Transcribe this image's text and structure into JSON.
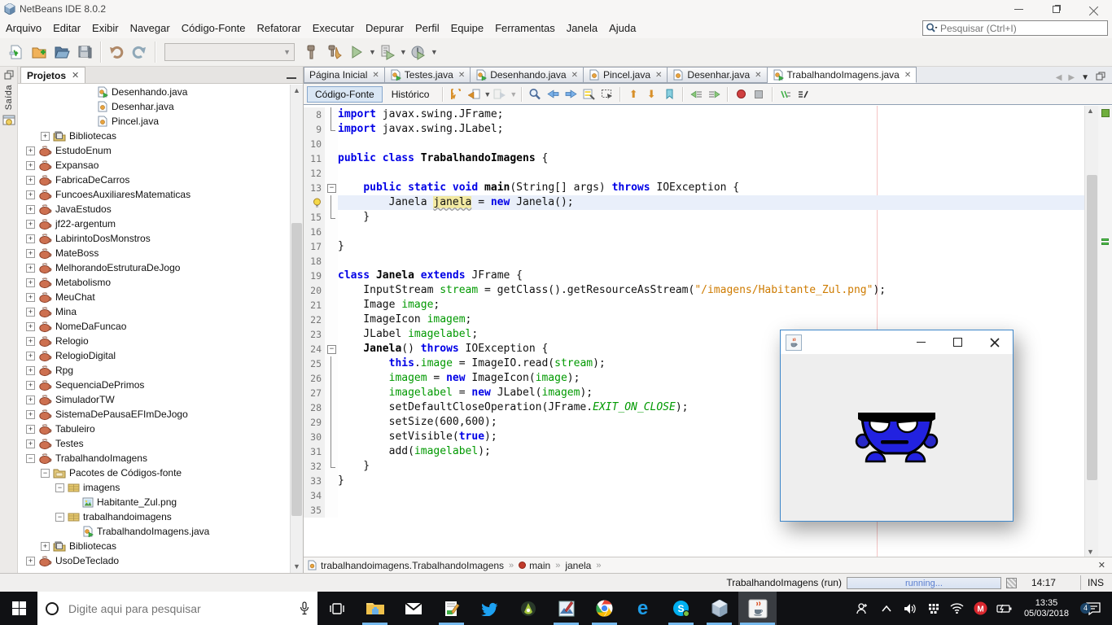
{
  "titlebar": {
    "title": "NetBeans IDE 8.0.2"
  },
  "menubar": {
    "items": [
      "Arquivo",
      "Editar",
      "Exibir",
      "Navegar",
      "Código-Fonte",
      "Refatorar",
      "Executar",
      "Depurar",
      "Perfil",
      "Equipe",
      "Ferramentas",
      "Janela",
      "Ajuda"
    ]
  },
  "quick_search": {
    "placeholder": "Pesquisar (Ctrl+I)"
  },
  "left_dock": {
    "output_label": "Saída"
  },
  "projects_panel": {
    "title": "Projetos",
    "tree": [
      {
        "lvl": 4,
        "box": "",
        "icon": "java-main",
        "label": "Desenhando.java"
      },
      {
        "lvl": 4,
        "box": "",
        "icon": "java",
        "label": "Desenhar.java"
      },
      {
        "lvl": 4,
        "box": "",
        "icon": "java",
        "label": "Pincel.java"
      },
      {
        "lvl": 1,
        "box": "+",
        "icon": "lib",
        "label": "Bibliotecas"
      },
      {
        "lvl": 0,
        "box": "+",
        "icon": "prj",
        "label": "EstudoEnum"
      },
      {
        "lvl": 0,
        "box": "+",
        "icon": "prj",
        "label": "Expansao"
      },
      {
        "lvl": 0,
        "box": "+",
        "icon": "prj",
        "label": "FabricaDeCarros"
      },
      {
        "lvl": 0,
        "box": "+",
        "icon": "prj",
        "label": "FuncoesAuxiliaresMatematicas"
      },
      {
        "lvl": 0,
        "box": "+",
        "icon": "prj",
        "label": "JavaEstudos"
      },
      {
        "lvl": 0,
        "box": "+",
        "icon": "prj",
        "label": "jf22-argentum"
      },
      {
        "lvl": 0,
        "box": "+",
        "icon": "prj",
        "label": "LabirintoDosMonstros"
      },
      {
        "lvl": 0,
        "box": "+",
        "icon": "prj",
        "label": "MateBoss"
      },
      {
        "lvl": 0,
        "box": "+",
        "icon": "prj",
        "label": "MelhorandoEstruturaDeJogo"
      },
      {
        "lvl": 0,
        "box": "+",
        "icon": "prj",
        "label": "Metabolismo"
      },
      {
        "lvl": 0,
        "box": "+",
        "icon": "prj",
        "label": "MeuChat"
      },
      {
        "lvl": 0,
        "box": "+",
        "icon": "prj",
        "label": "Mina"
      },
      {
        "lvl": 0,
        "box": "+",
        "icon": "prj",
        "label": "NomeDaFuncao"
      },
      {
        "lvl": 0,
        "box": "+",
        "icon": "prj",
        "label": "Relogio"
      },
      {
        "lvl": 0,
        "box": "+",
        "icon": "prj",
        "label": "RelogioDigital"
      },
      {
        "lvl": 0,
        "box": "+",
        "icon": "prj",
        "label": "Rpg"
      },
      {
        "lvl": 0,
        "box": "+",
        "icon": "prj",
        "label": "SequenciaDePrimos"
      },
      {
        "lvl": 0,
        "box": "+",
        "icon": "prj",
        "label": "SimuladorTW"
      },
      {
        "lvl": 0,
        "box": "+",
        "icon": "prj",
        "label": "SistemaDePausaEFImDeJogo"
      },
      {
        "lvl": 0,
        "box": "+",
        "icon": "prj",
        "label": "Tabuleiro"
      },
      {
        "lvl": 0,
        "box": "+",
        "icon": "prj",
        "label": "Testes"
      },
      {
        "lvl": 0,
        "box": "-",
        "icon": "prj",
        "label": "TrabalhandoImagens"
      },
      {
        "lvl": 1,
        "box": "-",
        "icon": "srcroot",
        "label": "Pacotes de Códigos-fonte"
      },
      {
        "lvl": 2,
        "box": "-",
        "icon": "pkg",
        "label": "imagens"
      },
      {
        "lvl": 3,
        "box": "",
        "icon": "img",
        "label": "Habitante_Zul.png"
      },
      {
        "lvl": 2,
        "box": "-",
        "icon": "pkg",
        "label": "trabalhandoimagens"
      },
      {
        "lvl": 3,
        "box": "",
        "icon": "java-main",
        "label": "TrabalhandoImagens.java"
      },
      {
        "lvl": 1,
        "box": "+",
        "icon": "lib",
        "label": "Bibliotecas"
      },
      {
        "lvl": 0,
        "box": "+",
        "icon": "prj",
        "label": "UsoDeTeclado"
      }
    ]
  },
  "editor": {
    "tabs": [
      {
        "label": "Página Inicial",
        "icon": "",
        "active": false
      },
      {
        "label": "Testes.java",
        "icon": "java-main",
        "active": false
      },
      {
        "label": "Desenhando.java",
        "icon": "java-main",
        "active": false
      },
      {
        "label": "Pincel.java",
        "icon": "java",
        "active": false
      },
      {
        "label": "Desenhar.java",
        "icon": "java",
        "active": false
      },
      {
        "label": "TrabalhandoImagens.java",
        "icon": "java-main",
        "active": true
      }
    ],
    "view_source_label": "Código-Fonte",
    "view_history_label": "Histórico",
    "code_lines": [
      {
        "n": "8",
        "fold": "mid",
        "cur": false,
        "bulb": false,
        "tokens": [
          [
            "k",
            "import"
          ],
          [
            "t",
            " javax.swing.JFrame;"
          ]
        ]
      },
      {
        "n": "9",
        "fold": "end",
        "cur": false,
        "bulb": false,
        "tokens": [
          [
            "k",
            "import"
          ],
          [
            "t",
            " javax.swing.JLabel;"
          ]
        ]
      },
      {
        "n": "10",
        "fold": "",
        "cur": false,
        "bulb": false,
        "tokens": []
      },
      {
        "n": "11",
        "fold": "",
        "cur": false,
        "bulb": false,
        "tokens": [
          [
            "k",
            "public"
          ],
          [
            "t",
            " "
          ],
          [
            "k",
            "class"
          ],
          [
            "t",
            " "
          ],
          [
            "b",
            "TrabalhandoImagens"
          ],
          [
            "t",
            " {"
          ]
        ]
      },
      {
        "n": "12",
        "fold": "",
        "cur": false,
        "bulb": false,
        "tokens": []
      },
      {
        "n": "13",
        "fold": "start",
        "cur": false,
        "bulb": false,
        "tokens": [
          [
            "t",
            "    "
          ],
          [
            "k",
            "public"
          ],
          [
            "t",
            " "
          ],
          [
            "k",
            "static"
          ],
          [
            "t",
            " "
          ],
          [
            "k",
            "void"
          ],
          [
            "t",
            " "
          ],
          [
            "b",
            "main"
          ],
          [
            "t",
            "(String[] args) "
          ],
          [
            "k",
            "throws"
          ],
          [
            "t",
            " IOException {"
          ]
        ]
      },
      {
        "n": "",
        "fold": "mid",
        "cur": true,
        "bulb": true,
        "tokens": [
          [
            "t",
            "        Janela "
          ],
          [
            "hl",
            "janela"
          ],
          [
            "t",
            " = "
          ],
          [
            "k",
            "new"
          ],
          [
            "t",
            " Janela();"
          ]
        ]
      },
      {
        "n": "15",
        "fold": "end",
        "cur": false,
        "bulb": false,
        "tokens": [
          [
            "t",
            "    }"
          ]
        ]
      },
      {
        "n": "16",
        "fold": "",
        "cur": false,
        "bulb": false,
        "tokens": []
      },
      {
        "n": "17",
        "fold": "",
        "cur": false,
        "bulb": false,
        "tokens": [
          [
            "t",
            "}"
          ]
        ]
      },
      {
        "n": "18",
        "fold": "",
        "cur": false,
        "bulb": false,
        "tokens": []
      },
      {
        "n": "19",
        "fold": "",
        "cur": false,
        "bulb": false,
        "tokens": [
          [
            "k",
            "class"
          ],
          [
            "t",
            " "
          ],
          [
            "b",
            "Janela"
          ],
          [
            "t",
            " "
          ],
          [
            "k",
            "extends"
          ],
          [
            "t",
            " JFrame {"
          ]
        ]
      },
      {
        "n": "20",
        "fold": "",
        "cur": false,
        "bulb": false,
        "tokens": [
          [
            "t",
            "    InputStream "
          ],
          [
            "g",
            "stream"
          ],
          [
            "t",
            " = getClass().getResourceAsStream("
          ],
          [
            "o",
            "\"/imagens/Habitante_Zul.png\""
          ],
          [
            "t",
            ");"
          ]
        ]
      },
      {
        "n": "21",
        "fold": "",
        "cur": false,
        "bulb": false,
        "tokens": [
          [
            "t",
            "    Image "
          ],
          [
            "g",
            "image"
          ],
          [
            "t",
            ";"
          ]
        ]
      },
      {
        "n": "22",
        "fold": "",
        "cur": false,
        "bulb": false,
        "tokens": [
          [
            "t",
            "    ImageIcon "
          ],
          [
            "g",
            "imagem"
          ],
          [
            "t",
            ";"
          ]
        ]
      },
      {
        "n": "23",
        "fold": "",
        "cur": false,
        "bulb": false,
        "tokens": [
          [
            "t",
            "    JLabel "
          ],
          [
            "g",
            "imagelabel"
          ],
          [
            "t",
            ";"
          ]
        ]
      },
      {
        "n": "24",
        "fold": "start",
        "cur": false,
        "bulb": false,
        "tokens": [
          [
            "t",
            "    "
          ],
          [
            "b",
            "Janela"
          ],
          [
            "t",
            "() "
          ],
          [
            "k",
            "throws"
          ],
          [
            "t",
            " IOException {"
          ]
        ]
      },
      {
        "n": "25",
        "fold": "mid",
        "cur": false,
        "bulb": false,
        "tokens": [
          [
            "t",
            "        "
          ],
          [
            "k",
            "this"
          ],
          [
            "t",
            "."
          ],
          [
            "g",
            "image"
          ],
          [
            "t",
            " = ImageIO.read("
          ],
          [
            "g",
            "stream"
          ],
          [
            "t",
            ");"
          ]
        ]
      },
      {
        "n": "26",
        "fold": "mid",
        "cur": false,
        "bulb": false,
        "tokens": [
          [
            "t",
            "        "
          ],
          [
            "g",
            "imagem"
          ],
          [
            "t",
            " = "
          ],
          [
            "k",
            "new"
          ],
          [
            "t",
            " ImageIcon("
          ],
          [
            "g",
            "image"
          ],
          [
            "t",
            ");"
          ]
        ]
      },
      {
        "n": "27",
        "fold": "mid",
        "cur": false,
        "bulb": false,
        "tokens": [
          [
            "t",
            "        "
          ],
          [
            "g",
            "imagelabel"
          ],
          [
            "t",
            " = "
          ],
          [
            "k",
            "new"
          ],
          [
            "t",
            " JLabel("
          ],
          [
            "g",
            "imagem"
          ],
          [
            "t",
            ");"
          ]
        ]
      },
      {
        "n": "28",
        "fold": "mid",
        "cur": false,
        "bulb": false,
        "tokens": [
          [
            "t",
            "        setDefaultCloseOperation(JFrame."
          ],
          [
            "gi",
            "EXIT_ON_CLOSE"
          ],
          [
            "t",
            ");"
          ]
        ]
      },
      {
        "n": "29",
        "fold": "mid",
        "cur": false,
        "bulb": false,
        "tokens": [
          [
            "t",
            "        setSize(600,600);"
          ]
        ]
      },
      {
        "n": "30",
        "fold": "mid",
        "cur": false,
        "bulb": false,
        "tokens": [
          [
            "t",
            "        setVisible("
          ],
          [
            "k",
            "true"
          ],
          [
            "t",
            ");"
          ]
        ]
      },
      {
        "n": "31",
        "fold": "mid",
        "cur": false,
        "bulb": false,
        "tokens": [
          [
            "t",
            "        add("
          ],
          [
            "g",
            "imagelabel"
          ],
          [
            "t",
            ");"
          ]
        ]
      },
      {
        "n": "32",
        "fold": "end",
        "cur": false,
        "bulb": false,
        "tokens": [
          [
            "t",
            "    }"
          ]
        ]
      },
      {
        "n": "33",
        "fold": "",
        "cur": false,
        "bulb": false,
        "tokens": [
          [
            "t",
            "}"
          ]
        ]
      },
      {
        "n": "34",
        "fold": "",
        "cur": false,
        "bulb": false,
        "tokens": []
      },
      {
        "n": "35",
        "fold": "",
        "cur": false,
        "bulb": false,
        "tokens": []
      }
    ]
  },
  "breadcrumb": {
    "items": [
      {
        "icon": "java-class",
        "label": "trabalhandoimagens.TrabalhandoImagens"
      },
      {
        "icon": "method",
        "label": "main"
      },
      {
        "icon": "",
        "label": "janela"
      }
    ]
  },
  "statusbar": {
    "task": "TrabalhandoImagens (run)",
    "progress_label": "running...",
    "clock": "14:17",
    "mode": "INS"
  },
  "taskbar": {
    "search_placeholder": "Digite aqui para pesquisar",
    "apps": [
      {
        "name": "task-view",
        "running": false,
        "active": false
      },
      {
        "name": "explorer",
        "running": true,
        "active": false
      },
      {
        "name": "mail",
        "running": false,
        "active": false
      },
      {
        "name": "notes-app",
        "running": true,
        "active": false
      },
      {
        "name": "twitter",
        "running": false,
        "active": false
      },
      {
        "name": "android-studio",
        "running": false,
        "active": false
      },
      {
        "name": "image-editor",
        "running": true,
        "active": false
      },
      {
        "name": "chrome",
        "running": true,
        "active": false
      },
      {
        "name": "edge",
        "running": false,
        "active": false
      },
      {
        "name": "skype",
        "running": true,
        "active": false
      },
      {
        "name": "netbeans",
        "running": true,
        "active": false
      },
      {
        "name": "java-app",
        "running": true,
        "active": true
      }
    ],
    "tray_time": "13:35",
    "tray_date": "05/03/2018",
    "notif_count": "4"
  },
  "colors": {
    "keyword": "#0000e6",
    "field_green": "#009900",
    "string_orange": "#ce7b00",
    "current_line": "#e9effa",
    "highlight_word": "#f2e9a2",
    "taskbar_underline": "#76b9ed",
    "sprite_blue": "#2222e0"
  }
}
